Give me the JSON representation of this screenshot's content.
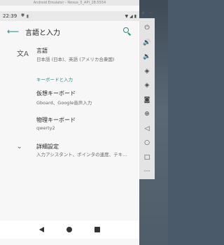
{
  "emulator": {
    "window_title": "Android Emulator - Nexus_5_API_28:5554"
  },
  "status_bar": {
    "time": "22:39",
    "notification_icon": "shield-icon",
    "wifi_icon": "wifi-icon",
    "signal_icon": "signal-icon",
    "battery_icon": "battery-icon"
  },
  "app_bar": {
    "title": "言語と入力",
    "back_icon": "arrow-back-icon",
    "search_icon": "search-icon"
  },
  "settings": {
    "language": {
      "title": "言語",
      "subtitle": "日本語 (日本)、英語 (アメリカ合衆国)",
      "icon": "translate-icon"
    },
    "keyboard_section_header": "キーボードと入力",
    "virtual_keyboard": {
      "title": "仮想キーボード",
      "subtitle": "Gboard、Google音声入力"
    },
    "physical_keyboard": {
      "title": "物理キーボード",
      "subtitle": "qwerty2"
    },
    "advanced": {
      "title": "詳細設定",
      "subtitle": "入力アシスタント、ポインタの速度、テキ...",
      "icon": "chevron-down-icon"
    }
  },
  "nav_bar": {
    "back": "nav-back-icon",
    "home": "nav-home-icon",
    "recents": "nav-recents-icon"
  },
  "side_toolbar": {
    "close_label": "×",
    "minimize_label": "−",
    "items": [
      "power-icon",
      "volume-up-icon",
      "volume-down-icon",
      "rotate-left-icon",
      "rotate-right-icon",
      "camera-icon",
      "zoom-icon",
      "back-icon",
      "home-icon",
      "overview-icon",
      "more-icon"
    ]
  },
  "colors": {
    "accent": "#2b8a7a",
    "background": "#f7f7f7"
  }
}
